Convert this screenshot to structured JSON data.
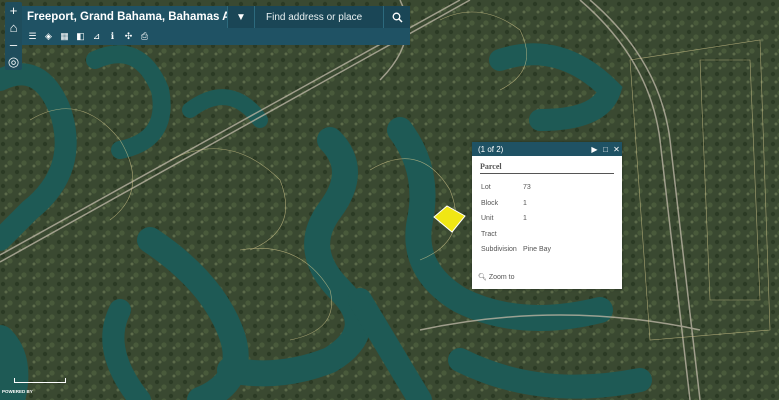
{
  "app": {
    "title": "Freeport, Grand Bahama, Bahamas Addresses",
    "search_placeholder": "Find address or place"
  },
  "zoom_controls": [
    {
      "name": "zoom-in-button",
      "glyph": "+"
    },
    {
      "name": "home-button",
      "glyph": "⌂"
    },
    {
      "name": "zoom-out-button",
      "glyph": "–"
    },
    {
      "name": "locate-button",
      "glyph": "◎"
    }
  ],
  "toolbar_icons": [
    "list-icon",
    "layers-icon",
    "basemap-icon",
    "legend-icon",
    "info-icon",
    "measure-icon",
    "share-icon",
    "print-icon"
  ],
  "popup": {
    "counter": "(1 of 2)",
    "layer_title": "Parcel",
    "fields": [
      {
        "label": "Lot",
        "value": "73"
      },
      {
        "label": "Block",
        "value": "1"
      },
      {
        "label": "Unit",
        "value": "1"
      },
      {
        "label": "Tract",
        "value": ""
      },
      {
        "label": "Subdivision",
        "value": "Pine Bay"
      }
    ],
    "zoom_to": "Zoom to"
  },
  "attribution": "POWERED BY",
  "colors": {
    "toolbar": "#1f5264",
    "water": "#1e5a55",
    "vegetation": "#33442c",
    "selected_parcel": "#f0e614"
  }
}
